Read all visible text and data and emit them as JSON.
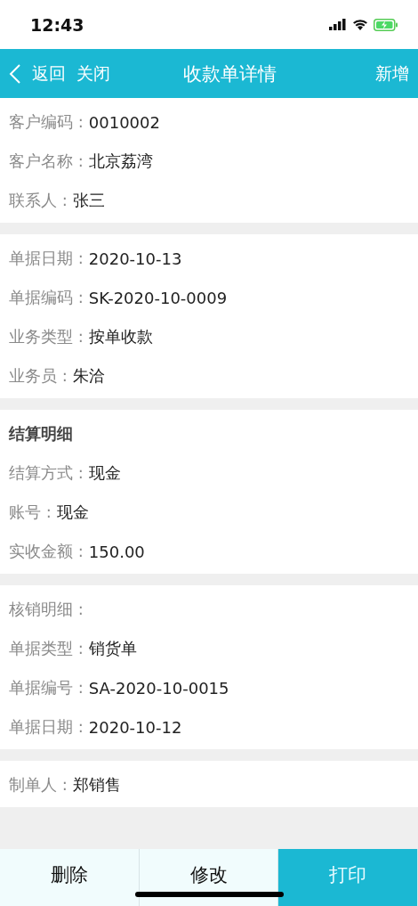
{
  "status_bar": {
    "time": "12:43"
  },
  "header": {
    "back": "返回",
    "close": "关闭",
    "title": "收款单详情",
    "action": "新增"
  },
  "sections": [
    {
      "rows": [
        {
          "kind": "field",
          "label": "客户编码 :",
          "value": "0010002"
        },
        {
          "kind": "field",
          "label": "客户名称 :",
          "value": "北京荔湾"
        },
        {
          "kind": "field",
          "label": "联系人 :",
          "value": "张三"
        }
      ]
    },
    {
      "rows": [
        {
          "kind": "field",
          "label": "单据日期 :",
          "value": "2020-10-13"
        },
        {
          "kind": "field",
          "label": "单据编码 :",
          "value": "SK-2020-10-0009"
        },
        {
          "kind": "field",
          "label": "业务类型 :",
          "value": "按单收款"
        },
        {
          "kind": "field",
          "label": "业务员 :",
          "value": "朱洽"
        }
      ]
    },
    {
      "rows": [
        {
          "kind": "heading",
          "label": "结算明细"
        },
        {
          "kind": "field",
          "label": "结算方式 :",
          "value": "现金"
        },
        {
          "kind": "field",
          "label": "账号 :",
          "value": "现金"
        },
        {
          "kind": "field",
          "label": "实收金额 :",
          "value": "150.00"
        }
      ]
    },
    {
      "rows": [
        {
          "kind": "caption",
          "label": "核销明细 :"
        },
        {
          "kind": "field",
          "label": "单据类型 :",
          "value": "销货单"
        },
        {
          "kind": "field",
          "label": "单据编号 :",
          "value": "SA-2020-10-0015"
        },
        {
          "kind": "field",
          "label": "单据日期 :",
          "value": "2020-10-12"
        }
      ]
    },
    {
      "rows": [
        {
          "kind": "field",
          "label": "制单人 :",
          "value": "郑销售"
        }
      ]
    }
  ],
  "buttons": [
    {
      "label": "删除",
      "kind": "plain"
    },
    {
      "label": "修改",
      "kind": "plain"
    },
    {
      "label": "打印",
      "kind": "primary"
    }
  ]
}
